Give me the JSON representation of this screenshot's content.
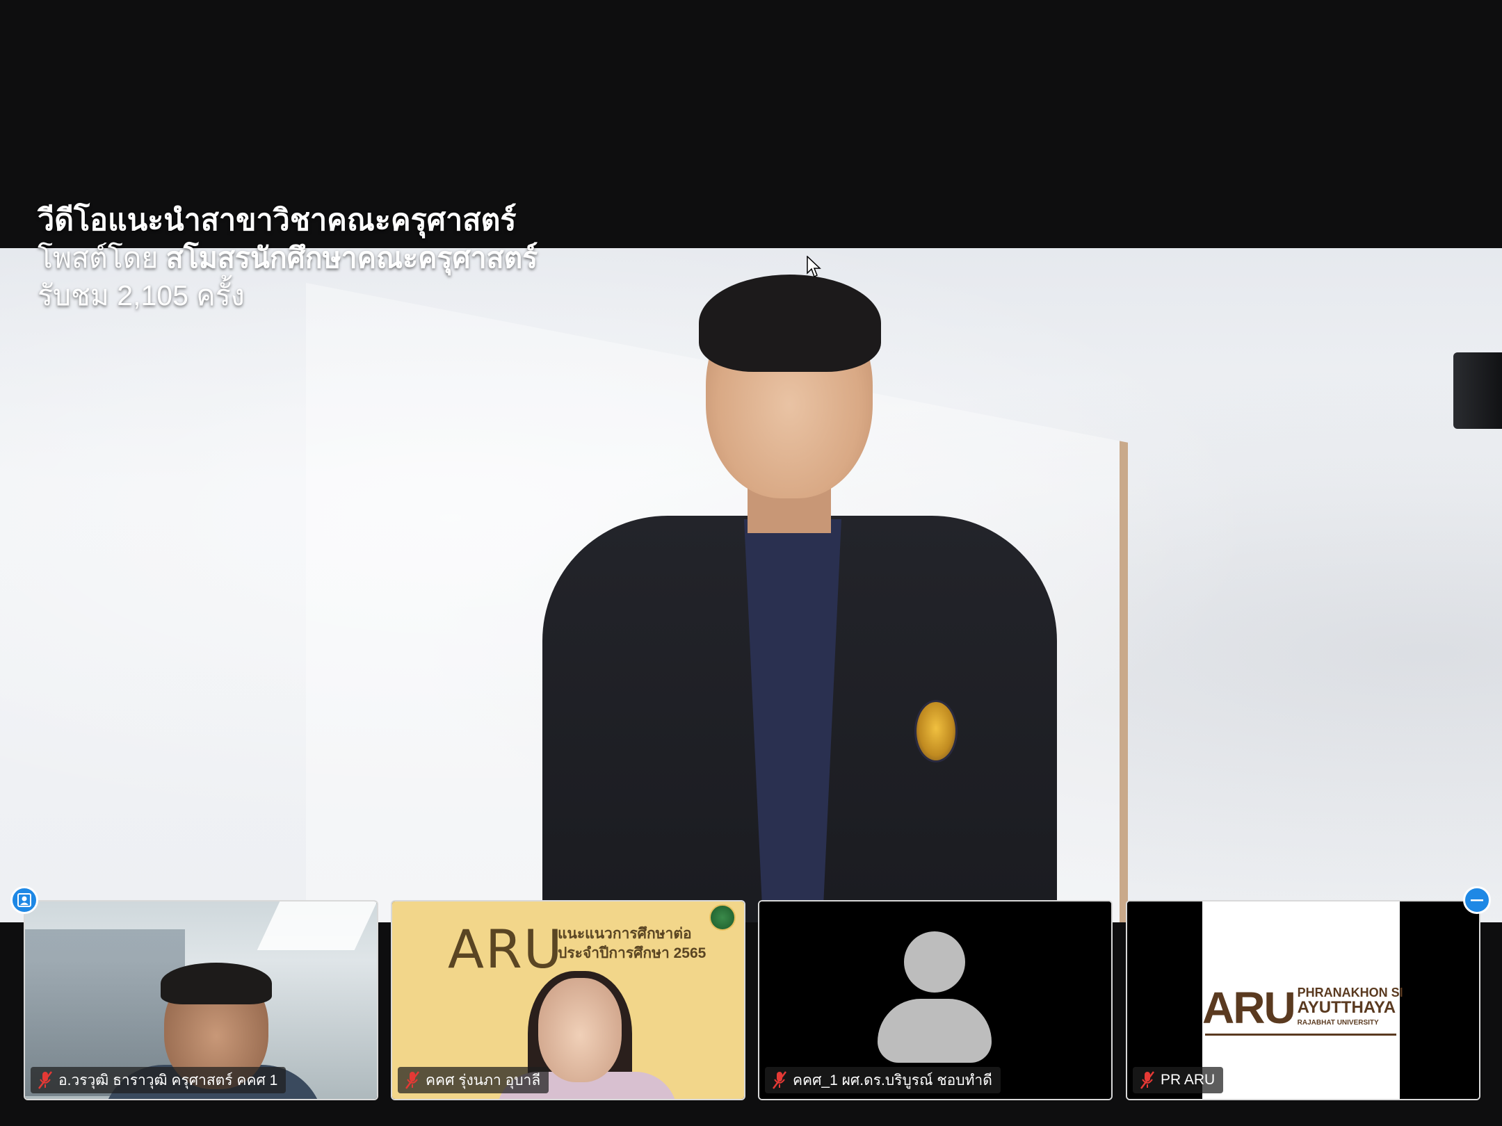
{
  "video": {
    "title": "วีดีโอแนะนำสาขาวิชาคณะครุศาสตร์",
    "posted_prefix": "โพสต์โดย",
    "posted_by": "สโมสรนักศึกษาคณะครุศาสตร์",
    "views": "รับชม 2,105 ครั้ง"
  },
  "participants": [
    {
      "name": "อ.วรวุฒิ ธาราวุฒิ ครุศาสตร์ คคศ 1",
      "muted": true,
      "video": "camera"
    },
    {
      "name": "คคศ  รุ่งนภา อุบาลี",
      "muted": true,
      "video": "camera",
      "background_text": {
        "logo": "ARU",
        "line1": "แนะแนวการศึกษาต่อ",
        "line2": "ประจำปีการศึกษา 2565"
      }
    },
    {
      "name": "คคศ_1 ผศ.ดร.บริบูรณ์ ชอบทำดี",
      "muted": true,
      "video": "avatar"
    },
    {
      "name": "PR ARU",
      "muted": true,
      "video": "logo",
      "logo_text": {
        "mark": "ARU",
        "line1": "PHRANAKHON SI",
        "line2": "AYUTTHAYA",
        "line3": "RAJABHAT UNIVERSITY"
      }
    }
  ],
  "controls": {
    "left_corner_icon": "person-icon",
    "right_corner_icon": "minimize-icon"
  },
  "colors": {
    "background": "#0e0e0f",
    "accent": "#1e88e5",
    "muted_mic": "#e53935"
  }
}
